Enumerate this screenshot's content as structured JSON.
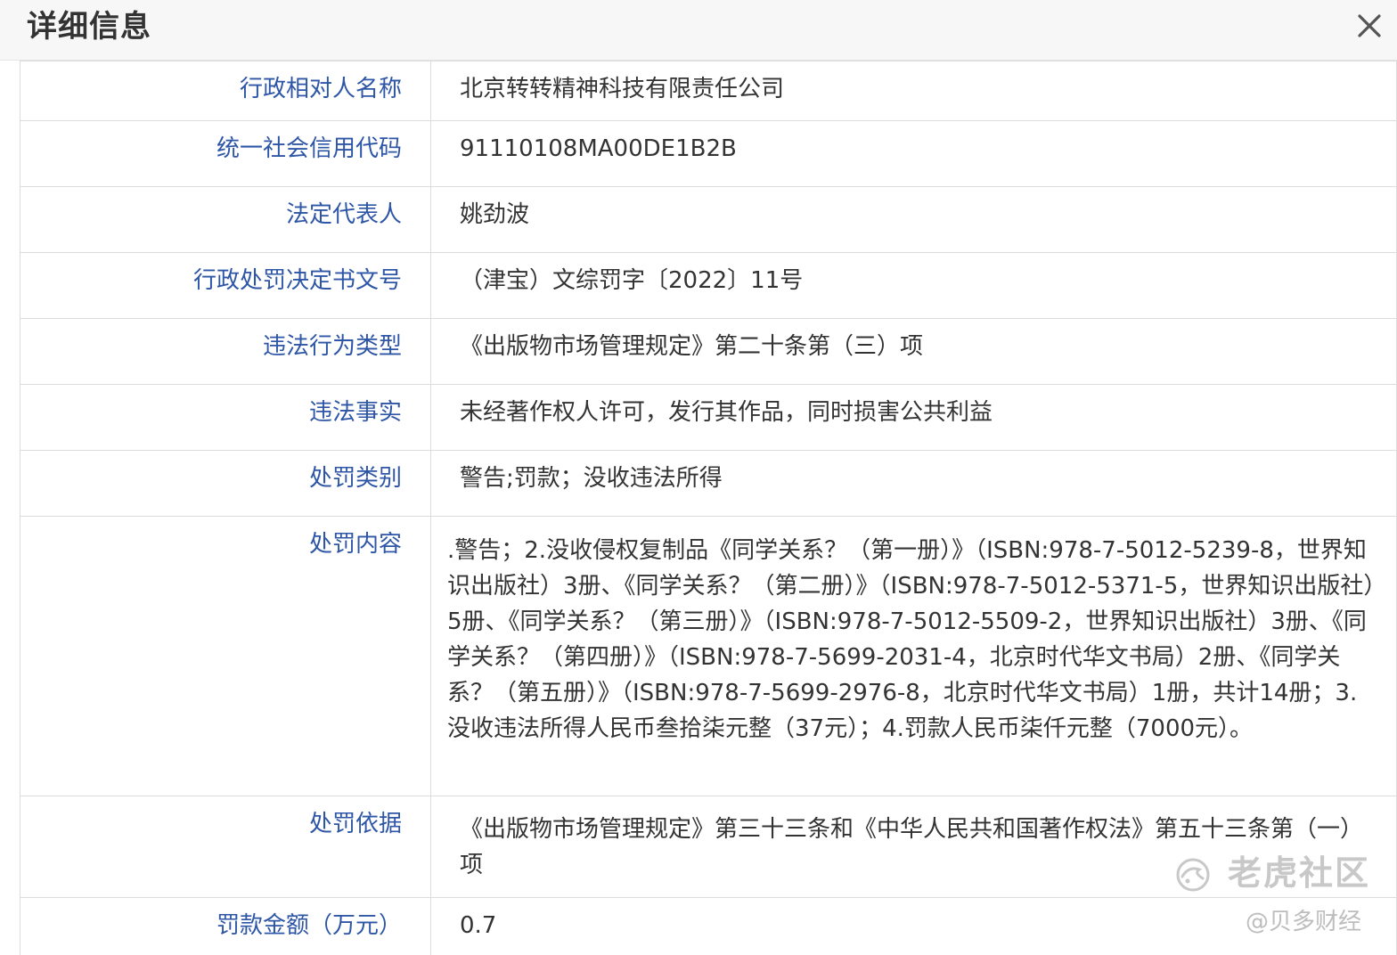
{
  "window": {
    "title": "详细信息"
  },
  "rows": [
    {
      "label": "行政相对人名称",
      "value": "北京转转精神科技有限责任公司"
    },
    {
      "label": "统一社会信用代码",
      "value": "91110108MA00DE1B2B"
    },
    {
      "label": "法定代表人",
      "value": "姚劲波"
    },
    {
      "label": "行政处罚决定书文号",
      "value": "（津宝）文综罚字〔2022〕11号"
    },
    {
      "label": "违法行为类型",
      "value": "《出版物市场管理规定》第二十条第（三）项"
    },
    {
      "label": "违法事实",
      "value": "未经著作权人许可，发行其作品，同时损害公共利益"
    },
    {
      "label": "处罚类别",
      "value": "警告;罚款；没收违法所得"
    },
    {
      "label": "处罚内容",
      "value": ".警告；2.没收侵权复制品《同学关系？（第一册）》（ISBN:978-7-5012-5239-8，世界知识出版社）3册、《同学关系？（第二册）》（ISBN:978-7-5012-5371-5，世界知识出版社）5册、《同学关系？（第三册）》（ISBN:978-7-5012-5509-2，世界知识出版社）3册、《同学关系？（第四册）》（ISBN:978-7-5699-2031-4，北京时代华文书局）2册、《同学关系？（第五册）》（ISBN:978-7-5699-2976-8，北京时代华文书局）1册，共计14册；3.没收违法所得人民币叁拾柒元整（37元）；4.罚款人民币柒仟元整（7000元）。"
    },
    {
      "label": "处罚依据",
      "value": "《出版物市场管理规定》第三十三条和《中华人民共和国著作权法》第五十三条第（一）项"
    },
    {
      "label": "罚款金额（万元）",
      "value": "0.7"
    }
  ],
  "watermark": {
    "brand": "老虎社区",
    "author": "@贝多财经"
  },
  "icons": {
    "close": "close-icon",
    "watermark_logo": "tiger-logo-icon"
  },
  "colors": {
    "label": "#2e56a6",
    "value": "#333333",
    "border": "#dcdcdc",
    "header_bg": "#f7f7f7"
  }
}
